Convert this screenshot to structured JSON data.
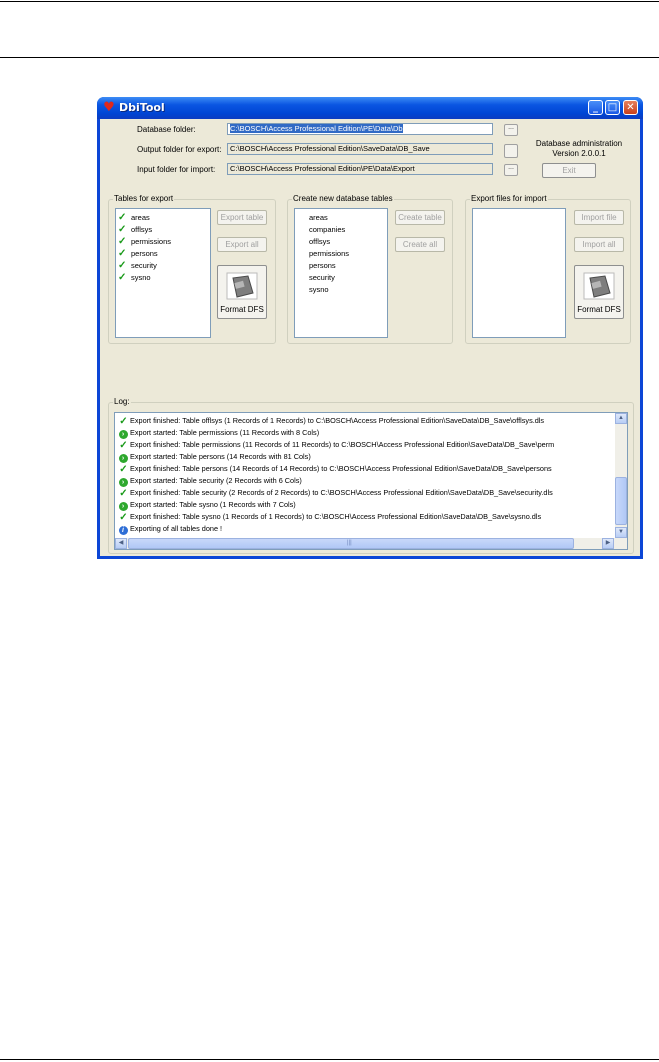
{
  "window": {
    "title": "DbiTool",
    "icon": "heart-icon",
    "controls": {
      "minimize": "_",
      "maximize": "□",
      "close": "✕"
    }
  },
  "folders": {
    "database_label": "Database folder:",
    "database_value": "C:\\BOSCH\\Access Professional Edition\\PE\\Data\\Db",
    "output_label": "Output folder for export:",
    "output_value": "C:\\BOSCH\\Access Professional Edition\\SaveData\\DB_Save",
    "input_label": "Input folder for import:",
    "input_value": "C:\\BOSCH\\Access Professional Edition\\PE\\Data\\Export",
    "browse_label": "..."
  },
  "info": {
    "line1": "Database administration",
    "line2": "Version 2.0.0.1",
    "exit_label": "Exit"
  },
  "export_group": {
    "title": "Tables for export",
    "tables": [
      "areas",
      "offlsys",
      "permissions",
      "persons",
      "security",
      "sysno"
    ],
    "export_table_label": "Export table",
    "export_all_label": "Export all",
    "format_label": "Format DFS"
  },
  "create_group": {
    "title": "Create new database tables",
    "tables": [
      "areas",
      "companies",
      "offlsys",
      "permissions",
      "persons",
      "security",
      "sysno"
    ],
    "create_table_label": "Create table",
    "create_all_label": "Create all"
  },
  "import_group": {
    "title": "Export files for import",
    "import_file_label": "Import file",
    "import_all_label": "Import all",
    "format_label": "Format DFS"
  },
  "log": {
    "title": "Log:",
    "lines": [
      {
        "type": "finished",
        "text": "Export finished: Table offlsys (1 Records of 1 Records) to C:\\BOSCH\\Access Professional Edition\\SaveData\\DB_Save\\offlsys.dls"
      },
      {
        "type": "started",
        "text": "Export started: Table permissions (11 Records with 8 Cols)"
      },
      {
        "type": "finished",
        "text": "Export finished: Table permissions (11 Records of 11 Records) to C:\\BOSCH\\Access Professional Edition\\SaveData\\DB_Save\\perm"
      },
      {
        "type": "started",
        "text": "Export started: Table persons (14 Records with 81 Cols)"
      },
      {
        "type": "finished",
        "text": "Export finished: Table persons (14 Records of 14 Records) to C:\\BOSCH\\Access Professional Edition\\SaveData\\DB_Save\\persons"
      },
      {
        "type": "started",
        "text": "Export started: Table security (2 Records with 6 Cols)"
      },
      {
        "type": "finished",
        "text": "Export finished: Table security (2 Records of 2 Records) to C:\\BOSCH\\Access Professional Edition\\SaveData\\DB_Save\\security.dls"
      },
      {
        "type": "started",
        "text": "Export started: Table sysno (1 Records with 7 Cols)"
      },
      {
        "type": "finished",
        "text": "Export finished: Table sysno (1 Records of 1 Records) to C:\\BOSCH\\Access Professional Edition\\SaveData\\DB_Save\\sysno.dls"
      },
      {
        "type": "info",
        "text": "Exporting of all tables done !"
      }
    ],
    "scroll": {
      "up": "▲",
      "down": "▼",
      "left": "◀",
      "right": "▶",
      "grip": "|||"
    }
  },
  "colors": {
    "title_bar": "#0b56e2",
    "client": "#ece9d8",
    "selection": "#316ac5",
    "check": "#1a9a1a"
  }
}
